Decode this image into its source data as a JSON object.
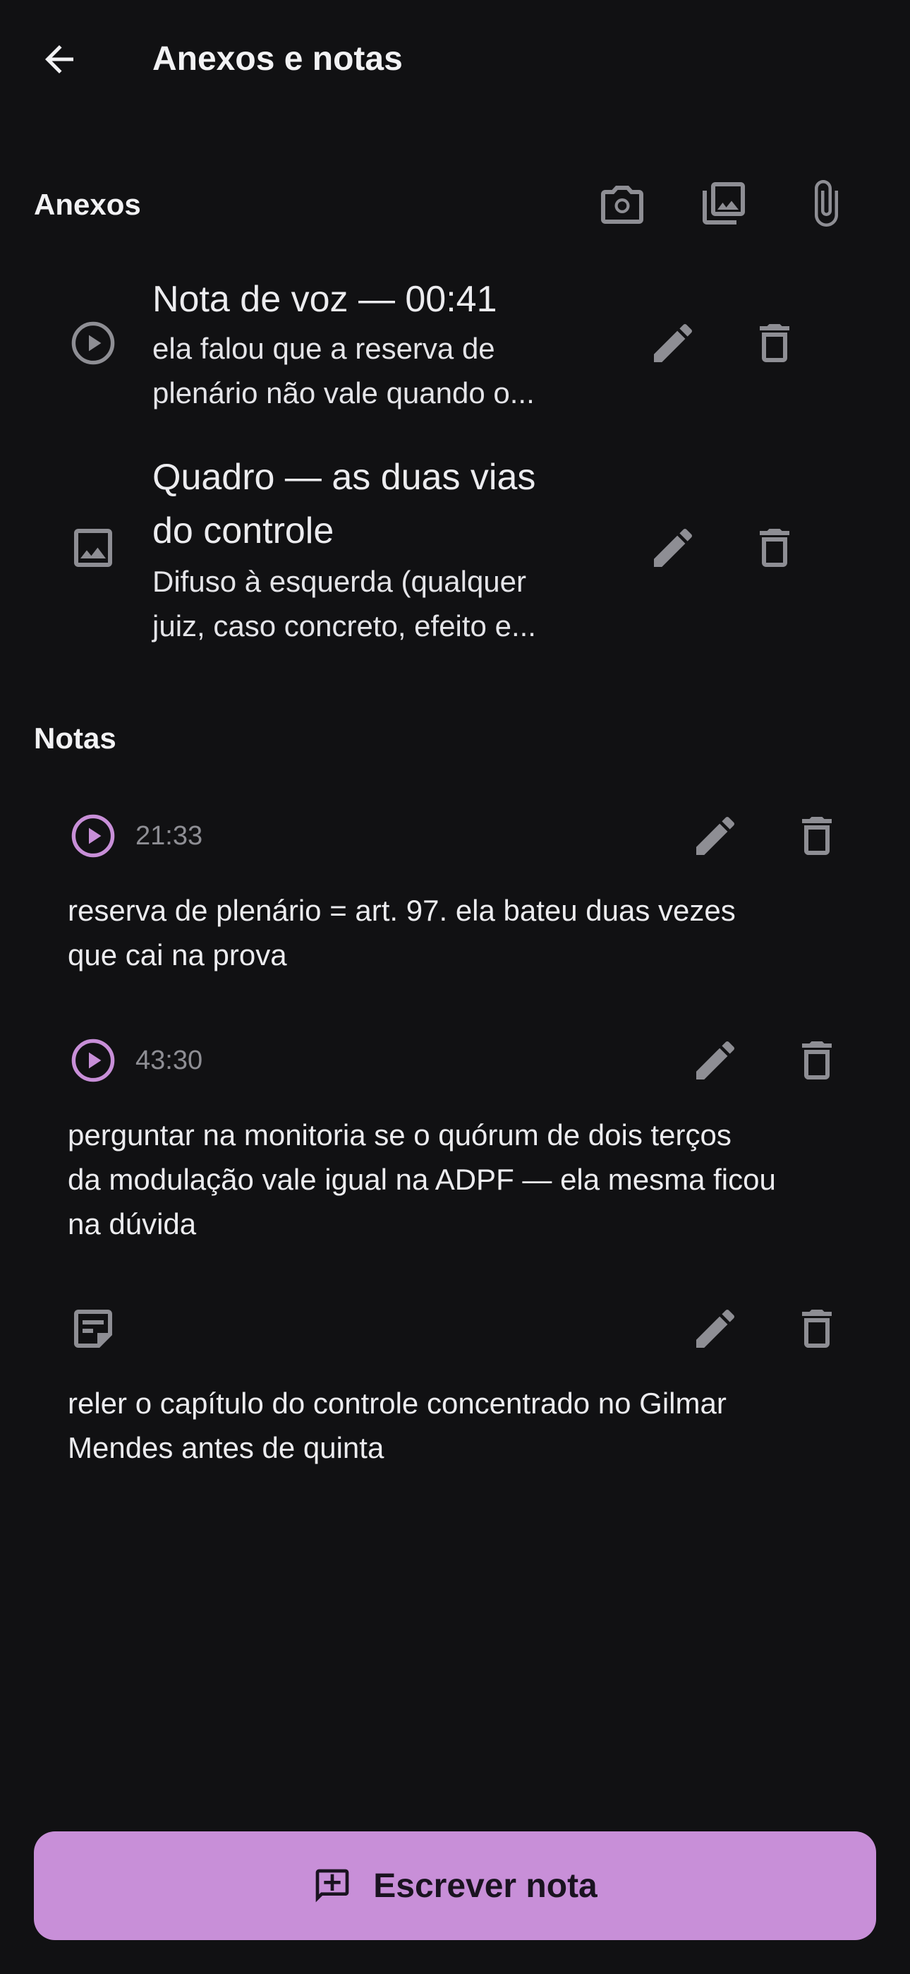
{
  "header": {
    "title": "Anexos e notas",
    "back_icon": "arrow-left-icon"
  },
  "attachments": {
    "section_title": "Anexos",
    "actions": [
      "camera-icon",
      "gallery-icon",
      "attach-icon"
    ],
    "items": [
      {
        "type_icon": "play-circle-icon",
        "title": "Nota de voz — 00:41",
        "desc_line1": "ela falou que a reserva de",
        "desc_line2": "plenário não vale quando o..."
      },
      {
        "type_icon": "image-icon",
        "title_line1": "Quadro — as duas vias",
        "title_line2": "do controle",
        "desc_line1": "Difuso à esquerda (qualquer",
        "desc_line2": "juiz, caso concreto, efeito e..."
      }
    ]
  },
  "notes": {
    "section_title": "Notas",
    "items": [
      {
        "type_icon": "play-circle-icon",
        "timestamp": "21:33",
        "line1": "reserva de plenário = art. 97. ela bateu duas vezes",
        "line2": "que cai na prova"
      },
      {
        "type_icon": "play-circle-icon",
        "timestamp": "43:30",
        "line1": "perguntar na monitoria se o quórum de dois terços",
        "line2": "da modulação vale igual na ADPF — ela mesma ficou",
        "line3": "na dúvida"
      },
      {
        "type_icon": "text-note-icon",
        "line1": "reler o capítulo do controle concentrado no Gilmar",
        "line2": "Mendes antes de quinta"
      }
    ]
  },
  "fab": {
    "label": "Escrever nota",
    "icon": "add-comment-icon"
  },
  "colors": {
    "background": "#111113",
    "accent": "#C88FD8",
    "icon_grey": "#8E8E94"
  }
}
